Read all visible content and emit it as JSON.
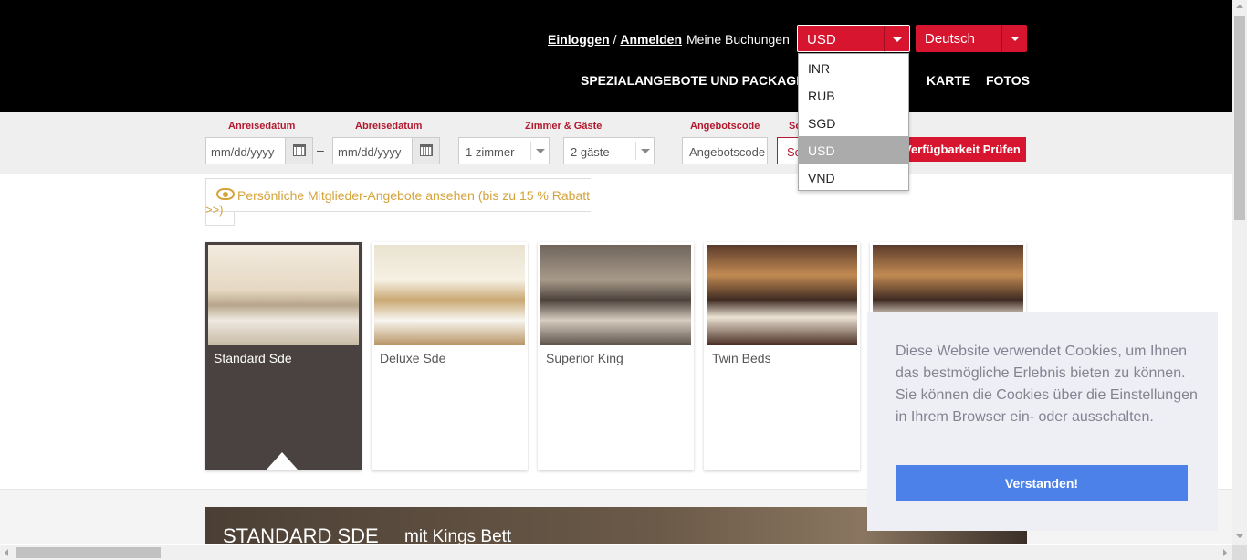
{
  "header": {
    "login_label": "Einloggen",
    "separator": "/",
    "register_label": "Anmelden",
    "bookings_label": "Meine Buchungen",
    "currency": {
      "selected": "USD",
      "options": [
        "INR",
        "RUB",
        "SGD",
        "USD",
        "VND"
      ]
    },
    "language": {
      "selected": "Deutsch"
    },
    "nav": {
      "specials": "SPEZIALANGEBOTE UND PACKAGES",
      "map": "KARTE",
      "photos": "FOTOS"
    }
  },
  "search": {
    "arrival_label": "Anreisedatum",
    "arrival_placeholder": "mm/dd/yyyy",
    "departure_label": "Abreisedatum",
    "departure_placeholder": "mm/dd/yyyy",
    "dash": "–",
    "rooms_guests_label": "Zimmer & Gäste",
    "rooms_value": "1 zimmer",
    "guests_value": "2 gäste",
    "offer_code_label": "Angebotscode",
    "offer_code_placeholder": "Angebotscode",
    "special_label": "So",
    "special_value": "So",
    "check_button": "Verfügbarkeit Prüfen"
  },
  "member_offer": {
    "text": "Persönliche Mitglieder-Angebote ansehen (bis zu 15 % Rabatt",
    "text_cont": ">>)"
  },
  "rooms": [
    {
      "name": "Standard Sde",
      "active": true
    },
    {
      "name": "Deluxe Sde",
      "active": false
    },
    {
      "name": "Superior King",
      "active": false
    },
    {
      "name": "Twin Beds",
      "active": false
    },
    {
      "name": "",
      "active": false
    }
  ],
  "cookie": {
    "text": "Diese Website verwendet Cookies, um Ihnen das bestmögliche Erlebnis bieten zu können. Sie können die Cookies über die Einstellungen in Ihrem Browser ein- oder ausschalten.",
    "button": "Verstanden!"
  },
  "room_detail": {
    "title": "STANDARD SDE",
    "subtitle": "mit Kings Bett"
  },
  "colors": {
    "brand_red": "#d8152f",
    "gold": "#d4a33a",
    "cookie_button": "#4b81e8",
    "active_card": "#4a4240"
  }
}
